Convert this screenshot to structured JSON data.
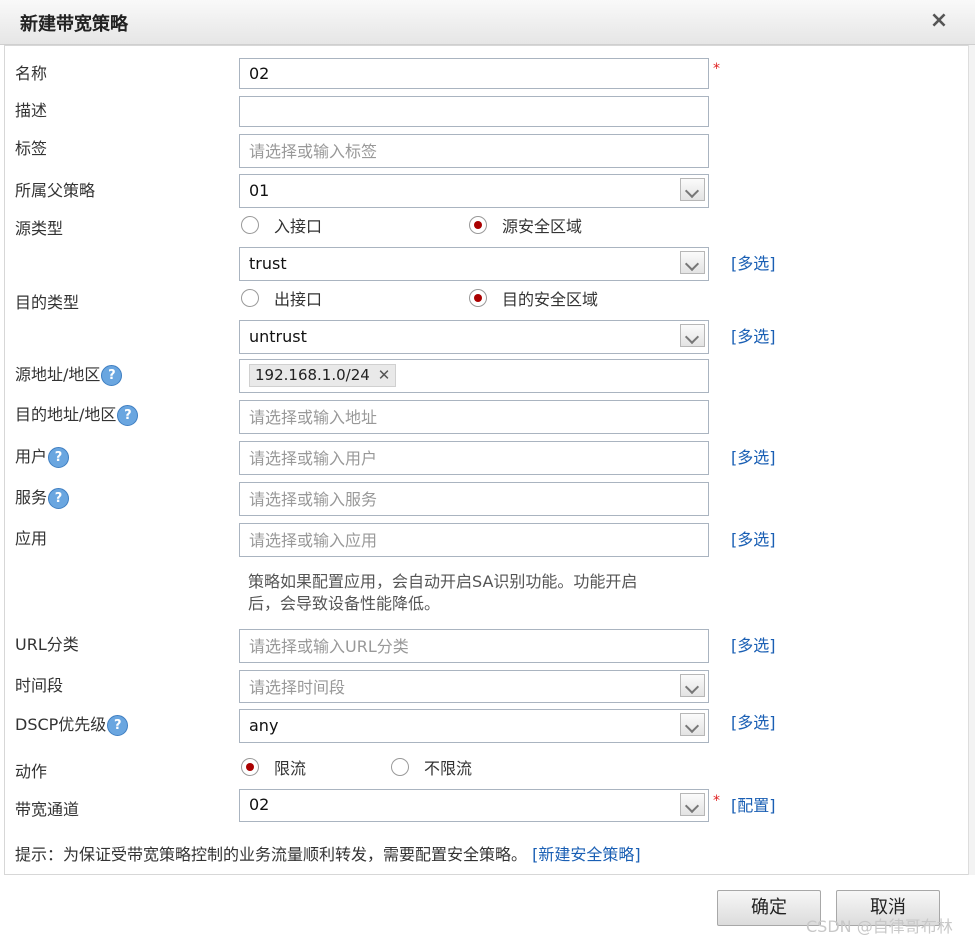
{
  "dialog": {
    "title": "新建带宽策略",
    "close_symbol": "×"
  },
  "form": {
    "name": {
      "label": "名称",
      "value": "02",
      "required_mark": "*"
    },
    "description": {
      "label": "描述",
      "value": ""
    },
    "tags": {
      "label": "标签",
      "placeholder": "请选择或输入标签"
    },
    "parent_policy": {
      "label": "所属父策略",
      "value": "01"
    },
    "source_type": {
      "label": "源类型",
      "options": [
        "入接口",
        "源安全区域"
      ],
      "selected": "源安全区域"
    },
    "source_zone": {
      "value": "trust",
      "multi_link": "[多选]"
    },
    "dest_type": {
      "label": "目的类型",
      "options": [
        "出接口",
        "目的安全区域"
      ],
      "selected": "目的安全区域"
    },
    "dest_zone": {
      "value": "untrust",
      "multi_link": "[多选]"
    },
    "source_address": {
      "label": "源地址/地区",
      "tag": "192.168.1.0/24",
      "tag_remove": "✕"
    },
    "dest_address": {
      "label": "目的地址/地区",
      "placeholder": "请选择或输入地址"
    },
    "user": {
      "label": "用户",
      "placeholder": "请选择或输入用户",
      "multi_link": "[多选]"
    },
    "service": {
      "label": "服务",
      "placeholder": "请选择或输入服务"
    },
    "application": {
      "label": "应用",
      "placeholder": "请选择或输入应用",
      "multi_link": "[多选]",
      "note_line1": "策略如果配置应用，会自动开启SA识别功能。功能开启",
      "note_line2": "后，会导致设备性能降低。"
    },
    "url_category": {
      "label": "URL分类",
      "placeholder": "请选择或输入URL分类",
      "multi_link": "[多选]"
    },
    "time_range": {
      "label": "时间段",
      "placeholder": "请选择时间段"
    },
    "dscp": {
      "label": "DSCP优先级",
      "value": "any",
      "multi_link": "[多选]"
    },
    "action": {
      "label": "动作",
      "options": [
        "限流",
        "不限流"
      ],
      "selected": "限流"
    },
    "bandwidth_channel": {
      "label": "带宽通道",
      "value": "02",
      "required_mark": "*",
      "config_link": "[配置]"
    }
  },
  "help_symbol": "?",
  "hint": {
    "text": "提示：为保证受带宽策略控制的业务流量顺利转发，需要配置安全策略。",
    "link": "[新建安全策略]"
  },
  "buttons": {
    "ok": "确定",
    "cancel": "取消"
  },
  "watermark": "CSDN @自律哥布林"
}
